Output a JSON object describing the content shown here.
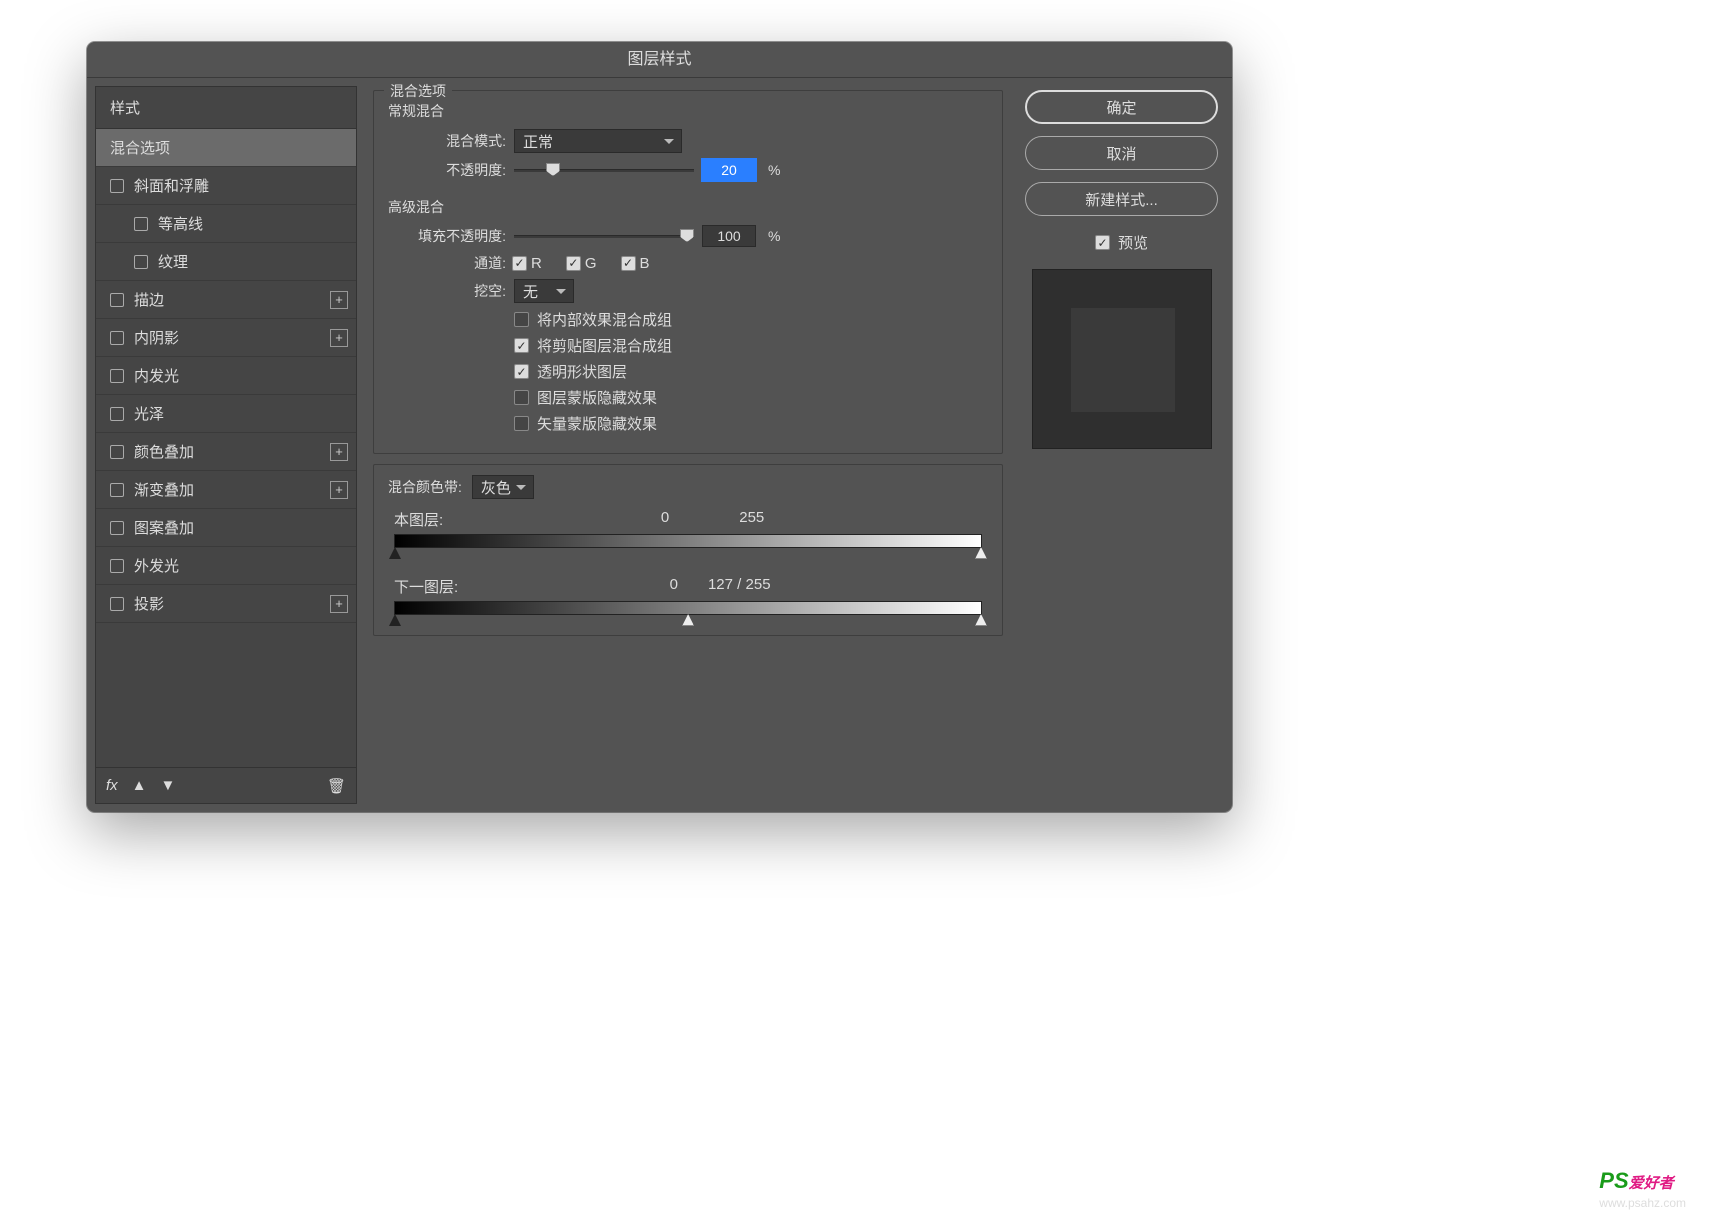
{
  "dialog": {
    "title": "图层样式"
  },
  "sidebar": {
    "header": "样式",
    "items": [
      {
        "label": "混合选项",
        "selected": true,
        "cb": false,
        "sub": false,
        "plus": false
      },
      {
        "label": "斜面和浮雕",
        "cb": true,
        "sub": false,
        "plus": false
      },
      {
        "label": "等高线",
        "cb": true,
        "sub": true,
        "plus": false
      },
      {
        "label": "纹理",
        "cb": true,
        "sub": true,
        "plus": false
      },
      {
        "label": "描边",
        "cb": true,
        "plus": true
      },
      {
        "label": "内阴影",
        "cb": true,
        "plus": true
      },
      {
        "label": "内发光",
        "cb": true,
        "plus": false
      },
      {
        "label": "光泽",
        "cb": true,
        "plus": false
      },
      {
        "label": "颜色叠加",
        "cb": true,
        "plus": true
      },
      {
        "label": "渐变叠加",
        "cb": true,
        "plus": true
      },
      {
        "label": "图案叠加",
        "cb": true,
        "plus": false
      },
      {
        "label": "外发光",
        "cb": true,
        "plus": false
      },
      {
        "label": "投影",
        "cb": true,
        "plus": true
      }
    ],
    "fx": "fx"
  },
  "main": {
    "legend": "混合选项",
    "general": {
      "title": "常规混合",
      "mode_label": "混合模式:",
      "mode_value": "正常",
      "opacity_label": "不透明度:",
      "opacity_value": "20",
      "pct": "%"
    },
    "advanced": {
      "title": "高级混合",
      "fill_label": "填充不透明度:",
      "fill_value": "100",
      "pct": "%",
      "channels_label": "通道:",
      "r": "R",
      "g": "G",
      "b": "B",
      "knockout_label": "挖空:",
      "knockout_value": "无",
      "opts": [
        {
          "label": "将内部效果混合成组",
          "on": false
        },
        {
          "label": "将剪贴图层混合成组",
          "on": true
        },
        {
          "label": "透明形状图层",
          "on": true
        },
        {
          "label": "图层蒙版隐藏效果",
          "on": false
        },
        {
          "label": "矢量蒙版隐藏效果",
          "on": false
        }
      ]
    },
    "blendif": {
      "label": "混合颜色带:",
      "value": "灰色",
      "this_label": "本图层:",
      "this_lo": "0",
      "this_hi": "255",
      "under_label": "下一图层:",
      "under_lo": "0",
      "under_mid": "127",
      "under_sep": "/",
      "under_hi": "255"
    }
  },
  "right": {
    "ok": "确定",
    "cancel": "取消",
    "newstyle": "新建样式...",
    "preview_label": "预览"
  },
  "watermark": {
    "brand": "PS",
    "tag": "爱好者",
    "url": "www.psahz.com"
  }
}
